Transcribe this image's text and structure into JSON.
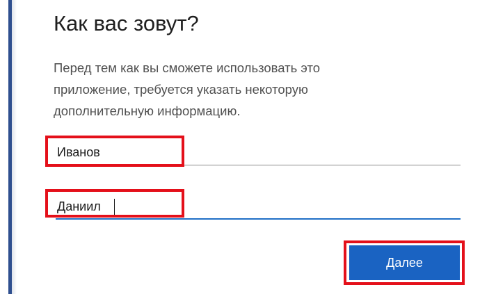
{
  "dialog": {
    "title": "Как вас зовут?",
    "description_lines": [
      "Перед тем как вы сможете использовать это",
      "приложение, требуется указать некоторую",
      "дополнительную информацию."
    ]
  },
  "form": {
    "surname_value": "Иванов",
    "name_value": "Даниил"
  },
  "actions": {
    "next_label": "Далее"
  },
  "colors": {
    "accent": "#1a63c2",
    "highlight": "#e4101a",
    "focus_underline": "#1f6fc6"
  }
}
